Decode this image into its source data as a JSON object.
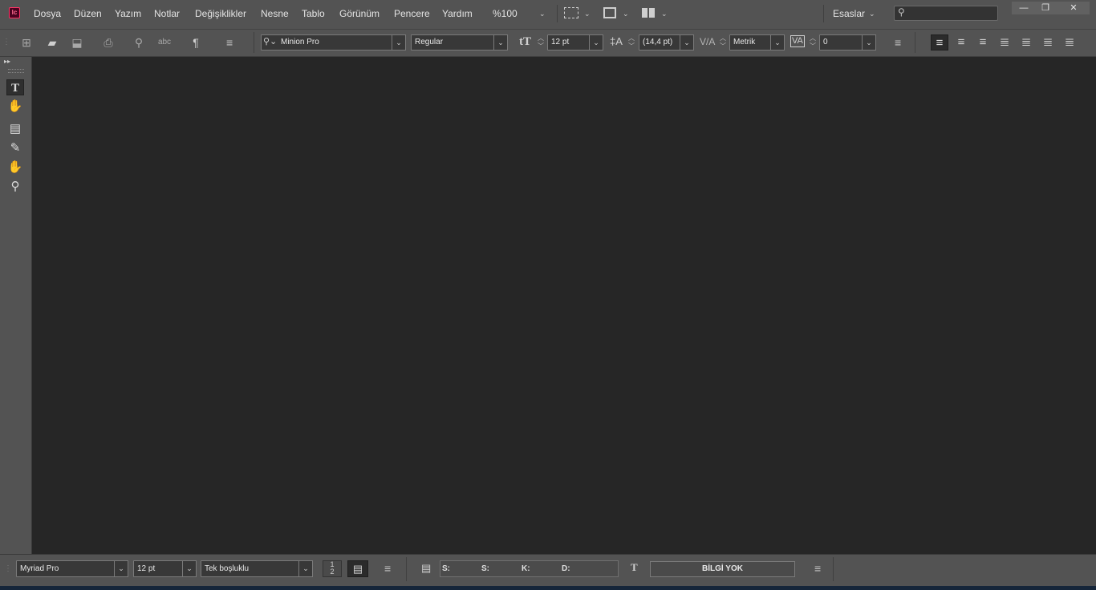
{
  "app": {
    "icon_text": "Ic",
    "accent": "#ff3366"
  },
  "menu": {
    "items": [
      "Dosya",
      "Düzen",
      "Yazım",
      "Notlar",
      "Değişiklikler",
      "Nesne",
      "Tablo",
      "Görünüm",
      "Pencere",
      "Yardım"
    ],
    "zoom": "%100",
    "workspace": "Esaslar"
  },
  "window_controls": {
    "minimize": "—",
    "restore": "❐",
    "close": "✕"
  },
  "control_bar": {
    "font_family": "Minion Pro",
    "font_style": "Regular",
    "font_size": "12 pt",
    "leading": "(14,4 pt)",
    "kerning": "Metrik",
    "tracking": "0"
  },
  "status_bar": {
    "font_family": "Myriad Pro",
    "font_size": "12 pt",
    "line_spacing": "Tek boşluklu",
    "coord_labels": [
      "S:",
      "S:",
      "K:",
      "D:"
    ],
    "info": "BİLGİ YOK"
  },
  "icons": [
    "new-document-icon",
    "open-icon",
    "save-icon",
    "print-icon",
    "find-icon",
    "spellcheck-icon",
    "pilcrow-icon",
    "menu-icon",
    "type-tool-icon",
    "position-tool-icon",
    "note-tool-icon",
    "eyedropper-icon",
    "hand-icon",
    "zoom-icon"
  ]
}
